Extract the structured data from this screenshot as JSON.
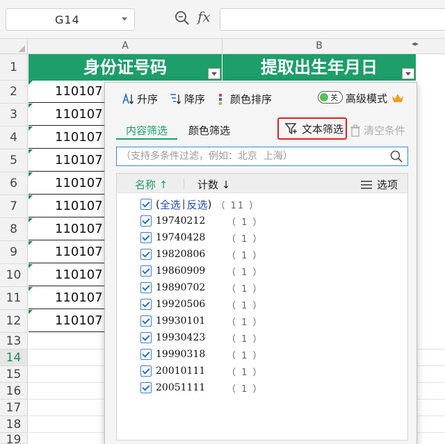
{
  "formula_bar": {
    "cell_ref": "G14",
    "fx_label": "fx"
  },
  "columns": [
    "A",
    "B"
  ],
  "rows": [
    "1",
    "2",
    "3",
    "4",
    "5",
    "6",
    "7",
    "8",
    "9",
    "10",
    "11",
    "12",
    "13",
    "14",
    "15",
    "16",
    "17",
    "18",
    "19"
  ],
  "active_row": "14",
  "headers": {
    "a": "身份证号码",
    "b": "提取出生年月日"
  },
  "cells_a": [
    "110107",
    "110107",
    "110107",
    "110107",
    "110107",
    "110107",
    "110107",
    "110107",
    "110107",
    "110107",
    "110107"
  ],
  "filter": {
    "sort_asc": "升序",
    "sort_desc": "降序",
    "color_sort": "颜色排序",
    "toggle_text": "关",
    "advanced_mode": "高级模式",
    "tab_content": "内容筛选",
    "tab_color": "颜色筛选",
    "text_filter": "文本筛选",
    "clear": "清空条件",
    "search_placeholder": "（支持多条件过滤，例如：北京  上海）",
    "col_name": "名称 ↑",
    "col_count": "计数 ↓",
    "options": "选项",
    "select_all": "全选",
    "invert": "反选",
    "total": "（ 11 ）",
    "items": [
      {
        "label": "19740212",
        "count": "（ 1 ）"
      },
      {
        "label": "19740428",
        "count": "（ 1 ）"
      },
      {
        "label": "19820806",
        "count": "（ 1 ）"
      },
      {
        "label": "19860909",
        "count": "（ 1 ）"
      },
      {
        "label": "19890702",
        "count": "（ 1 ）"
      },
      {
        "label": "19920506",
        "count": "（ 1 ）"
      },
      {
        "label": "19930101",
        "count": "（ 1 ）"
      },
      {
        "label": "19930423",
        "count": "（ 1 ）"
      },
      {
        "label": "19990318",
        "count": "（ 1 ）"
      },
      {
        "label": "20010111",
        "count": "（ 1 ）"
      },
      {
        "label": "20051111",
        "count": "（ 1 ）"
      }
    ]
  },
  "colors": {
    "header_green": "#1e9e6a",
    "highlight_red": "#e02020",
    "checkbox_blue": "#3b7fd0"
  }
}
